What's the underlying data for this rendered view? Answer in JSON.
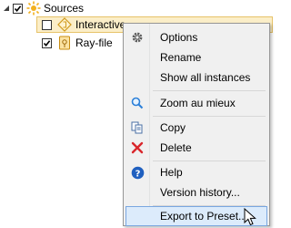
{
  "tree": {
    "root": {
      "label": "Sources",
      "checked": true
    },
    "children": [
      {
        "label": "Interactive",
        "checked": false,
        "selected": true
      },
      {
        "label": "Ray-file",
        "checked": true
      }
    ]
  },
  "context_menu": {
    "items": [
      {
        "label": "Options",
        "icon": "gear-icon"
      },
      {
        "label": "Rename",
        "icon": ""
      },
      {
        "label": "Show all instances",
        "icon": ""
      },
      {
        "label": "Zoom au mieux",
        "icon": "magnifier-icon"
      },
      {
        "label": "Copy",
        "icon": "copy-icon"
      },
      {
        "label": "Delete",
        "icon": "delete-x-icon"
      },
      {
        "label": "Help",
        "icon": "help-icon"
      },
      {
        "label": "Version history...",
        "icon": ""
      },
      {
        "label": "Export to Preset...",
        "icon": "",
        "hovered": true
      }
    ]
  },
  "colors": {
    "selection_bg": "#fbeec8",
    "menu_hover_bg": "#dcebfb",
    "delete_red": "#d9262b",
    "help_blue": "#1f5fbf"
  }
}
